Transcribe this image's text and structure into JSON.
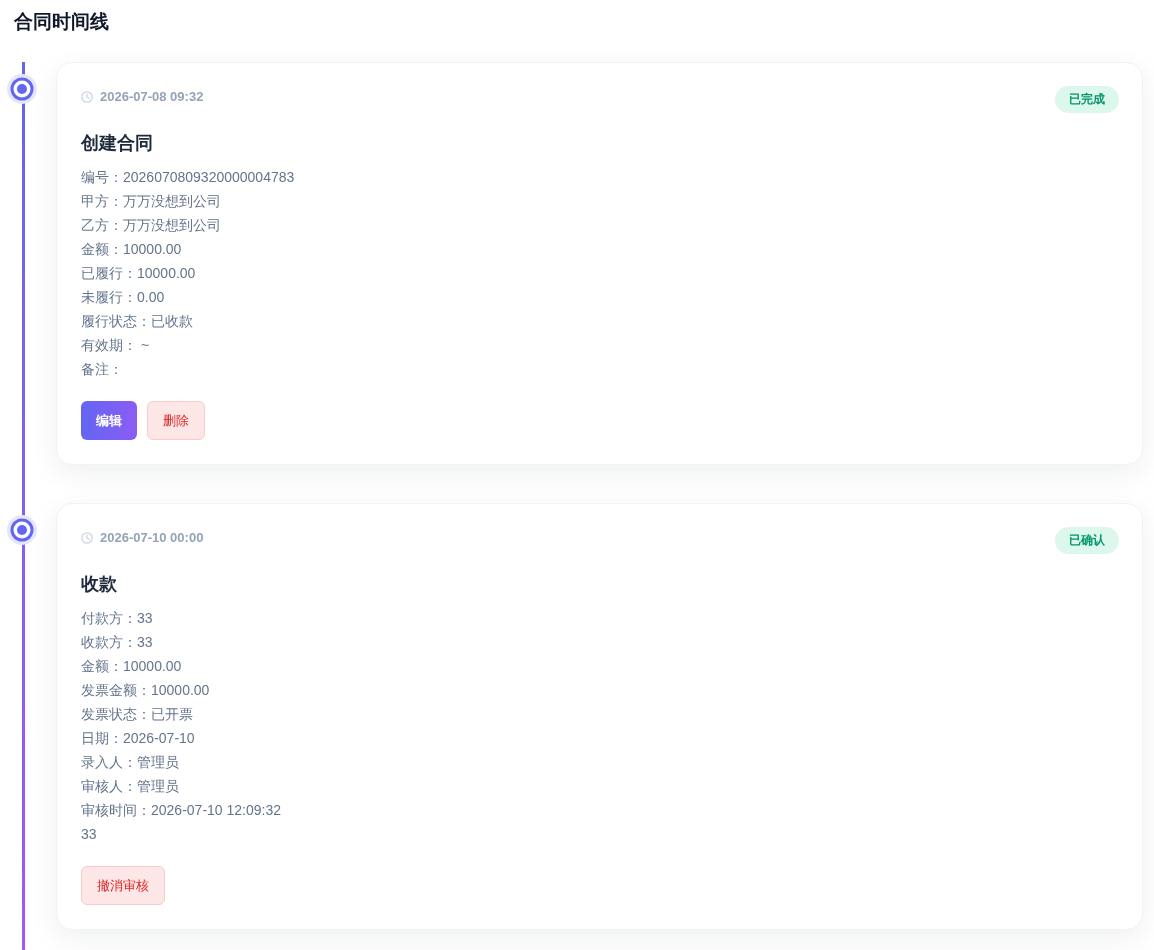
{
  "title": "合同时间线",
  "events": [
    {
      "time": "2026-07-08 09:32",
      "status": "已完成",
      "title": "创建合同",
      "details": [
        "编号：2026070809320000004783",
        "甲方：万万没想到公司",
        "乙方：万万没想到公司",
        "金额：10000.00",
        "已履行：10000.00",
        "未履行：0.00",
        "履行状态：已收款",
        "有效期： ~",
        "备注："
      ],
      "actions": [
        {
          "label": "编辑",
          "kind": "primary"
        },
        {
          "label": "删除",
          "kind": "danger"
        }
      ]
    },
    {
      "time": "2026-07-10 00:00",
      "status": "已确认",
      "title": "收款",
      "details": [
        "付款方：33",
        "收款方：33",
        "金额：10000.00",
        "发票金额：10000.00",
        "发票状态：已开票",
        "日期：2026-07-10",
        "录入人：管理员",
        "审核人：管理员",
        "审核时间：2026-07-10 12:09:32",
        "33"
      ],
      "actions": [
        {
          "label": "撤消审核",
          "kind": "danger"
        }
      ]
    }
  ]
}
